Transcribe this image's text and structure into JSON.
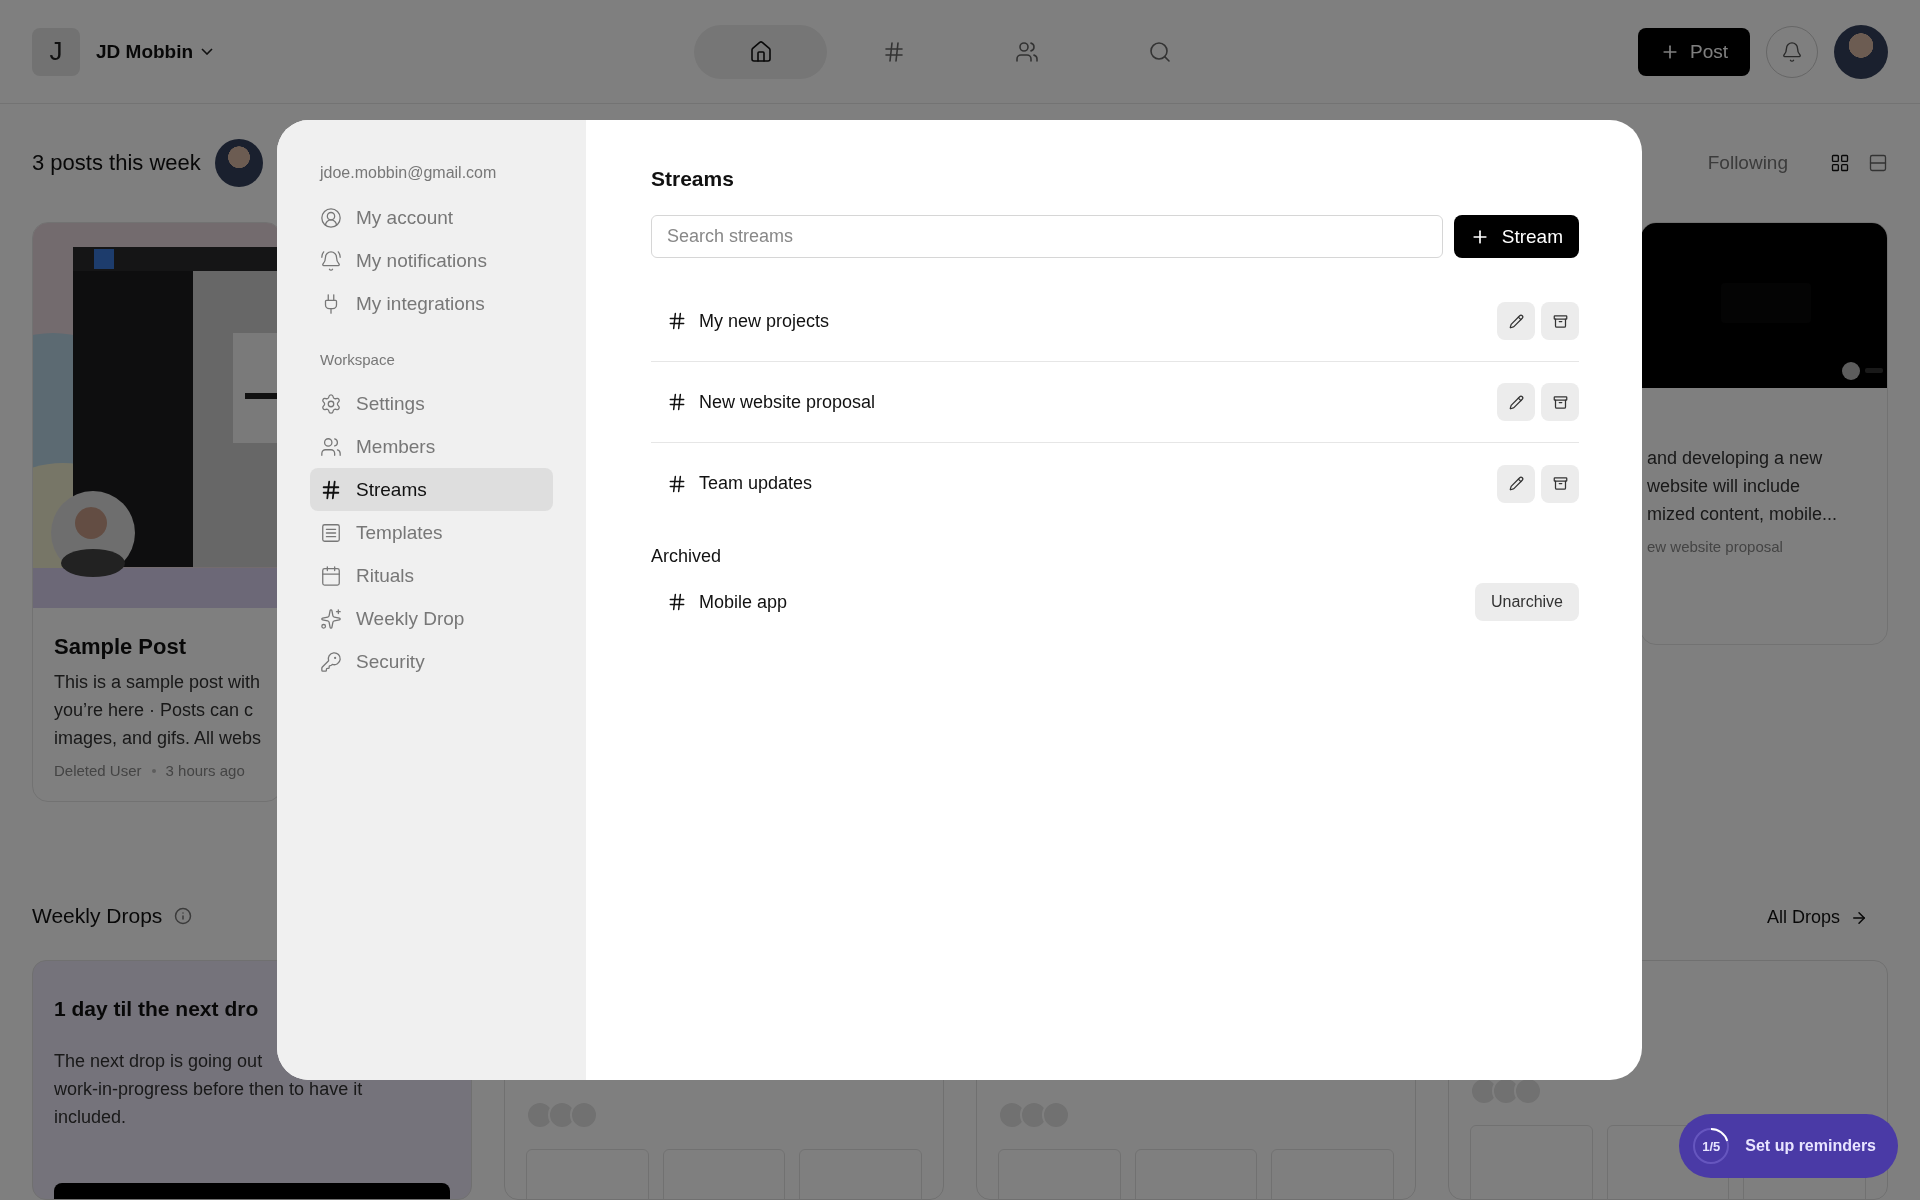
{
  "header": {
    "workspace_initial": "J",
    "workspace_name": "JD Mobbin",
    "nav": [
      {
        "kind": "home",
        "selected": true
      },
      {
        "kind": "streams",
        "selected": false
      },
      {
        "kind": "people",
        "selected": false
      },
      {
        "kind": "search",
        "selected": false
      }
    ],
    "post_button": "Post"
  },
  "feed": {
    "summary": "3 posts this week",
    "filter": "Following",
    "posts": [
      {
        "kind": "sample",
        "title": "Sample Post",
        "lines": [
          "This is a sample post with",
          "you’re here · Posts can c",
          "images, and gifs. All webs"
        ],
        "author": "Deleted User",
        "time": "3 hours ago"
      },
      {
        "kind": "video",
        "lines": [
          "and developing a new",
          "website will include",
          "mized content, mobile..."
        ],
        "stream": "ew website proposal"
      }
    ]
  },
  "drops": {
    "title": "Weekly Drops",
    "link": "All Drops",
    "next_title": "1 day til the next dro",
    "next_lines": [
      "The next drop is going out",
      "work-in-progress before then to have it",
      "included."
    ]
  },
  "reminders": {
    "progress": "1/5",
    "level": 0.2,
    "label": "Set up reminders"
  },
  "settings": {
    "email": "jdoe.mobbin@gmail.com",
    "personal": [
      {
        "kind": "account",
        "label": "My account",
        "selected": false
      },
      {
        "kind": "notifications",
        "label": "My notifications",
        "selected": false
      },
      {
        "kind": "integrations",
        "label": "My integrations",
        "selected": false
      }
    ],
    "workspace_heading": "Workspace",
    "workspace": [
      {
        "kind": "settings",
        "label": "Settings",
        "selected": false
      },
      {
        "kind": "members",
        "label": "Members",
        "selected": false
      },
      {
        "kind": "streams",
        "label": "Streams",
        "selected": true
      },
      {
        "kind": "templates",
        "label": "Templates",
        "selected": false
      },
      {
        "kind": "rituals",
        "label": "Rituals",
        "selected": false
      },
      {
        "kind": "weekly",
        "label": "Weekly Drop",
        "selected": false
      },
      {
        "kind": "security",
        "label": "Security",
        "selected": false
      }
    ],
    "streams": {
      "title": "Streams",
      "search_placeholder": "Search streams",
      "add_button": "Stream",
      "active": [
        {
          "name": "My new projects"
        },
        {
          "name": "New website proposal"
        },
        {
          "name": "Team updates"
        }
      ],
      "archived_heading": "Archived",
      "archived": [
        {
          "name": "Mobile app",
          "action": "Unarchive"
        }
      ]
    }
  }
}
